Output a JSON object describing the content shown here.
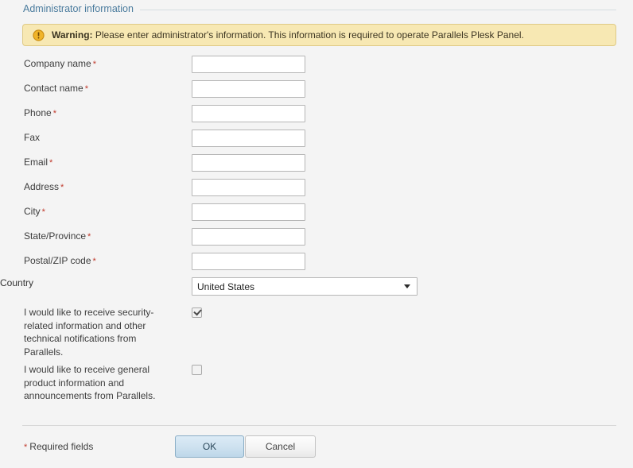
{
  "section": {
    "title": "Administrator information"
  },
  "warning": {
    "icon": "exclamation-circle-icon",
    "label": "Warning:",
    "message": "Please enter administrator's information. This information is required to operate Parallels Plesk Panel.",
    "bg_color": "#f7e8b3",
    "border_color": "#dfca86"
  },
  "fields": [
    {
      "label": "Company name",
      "required": true,
      "value": "",
      "placeholder": ""
    },
    {
      "label": "Contact name",
      "required": true,
      "value": "",
      "placeholder": ""
    },
    {
      "label": "Phone",
      "required": true,
      "value": "",
      "placeholder": ""
    },
    {
      "label": "Fax",
      "required": false,
      "value": "",
      "placeholder": ""
    },
    {
      "label": "Email",
      "required": true,
      "value": "",
      "placeholder": ""
    },
    {
      "label": "Address",
      "required": true,
      "value": "",
      "placeholder": ""
    },
    {
      "label": "City",
      "required": true,
      "value": "",
      "placeholder": ""
    },
    {
      "label": "State/Province",
      "required": true,
      "value": "",
      "placeholder": ""
    },
    {
      "label": "Postal/ZIP code",
      "required": true,
      "value": "",
      "placeholder": ""
    }
  ],
  "country": {
    "label": "Country",
    "required": false,
    "selected": "United States",
    "caret_icon": "chevron-down-icon"
  },
  "checkboxes": [
    {
      "label": "I would like to receive security-related information and other technical notifications from Parallels.",
      "checked": true
    },
    {
      "label": "I would like to receive general product information and announcements from Parallels.",
      "checked": false
    }
  ],
  "footer": {
    "required_marker": "*",
    "required_note": "Required fields",
    "ok_label": "OK",
    "cancel_label": "Cancel",
    "ok_accent": "#bdd7e9"
  },
  "required_marker": "*"
}
